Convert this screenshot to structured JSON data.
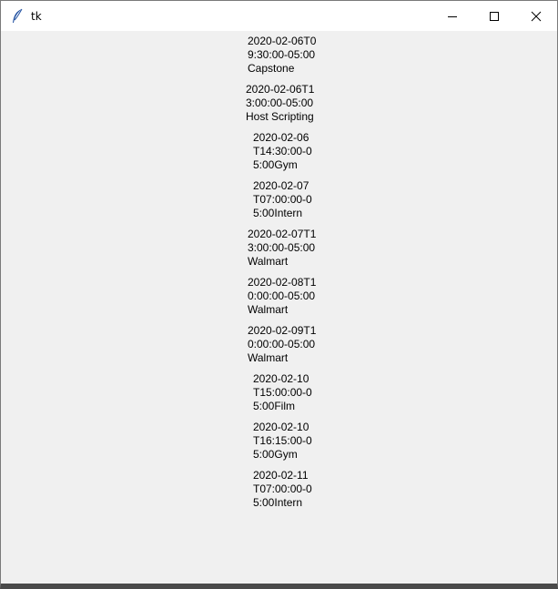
{
  "window": {
    "title": "tk",
    "icon": "tk-feather-icon",
    "controls": [
      "minimize-icon",
      "maximize-icon",
      "close-icon"
    ]
  },
  "events": [
    "2020-02-06T0\n9:30:00-05:00\nCapstone",
    "2020-02-06T1\n3:00:00-05:00\nHost Scripting",
    "2020-02-06\nT14:30:00-0\n5:00Gym",
    "2020-02-07\nT07:00:00-0\n5:00Intern",
    "2020-02-07T1\n3:00:00-05:00\nWalmart",
    "2020-02-08T1\n0:00:00-05:00\nWalmart",
    "2020-02-09T1\n0:00:00-05:00\nWalmart",
    "2020-02-10\nT15:00:00-0\n5:00Film",
    "2020-02-10\nT16:15:00-0\n5:00Gym",
    "2020-02-11\nT07:00:00-0\n5:00Intern"
  ]
}
